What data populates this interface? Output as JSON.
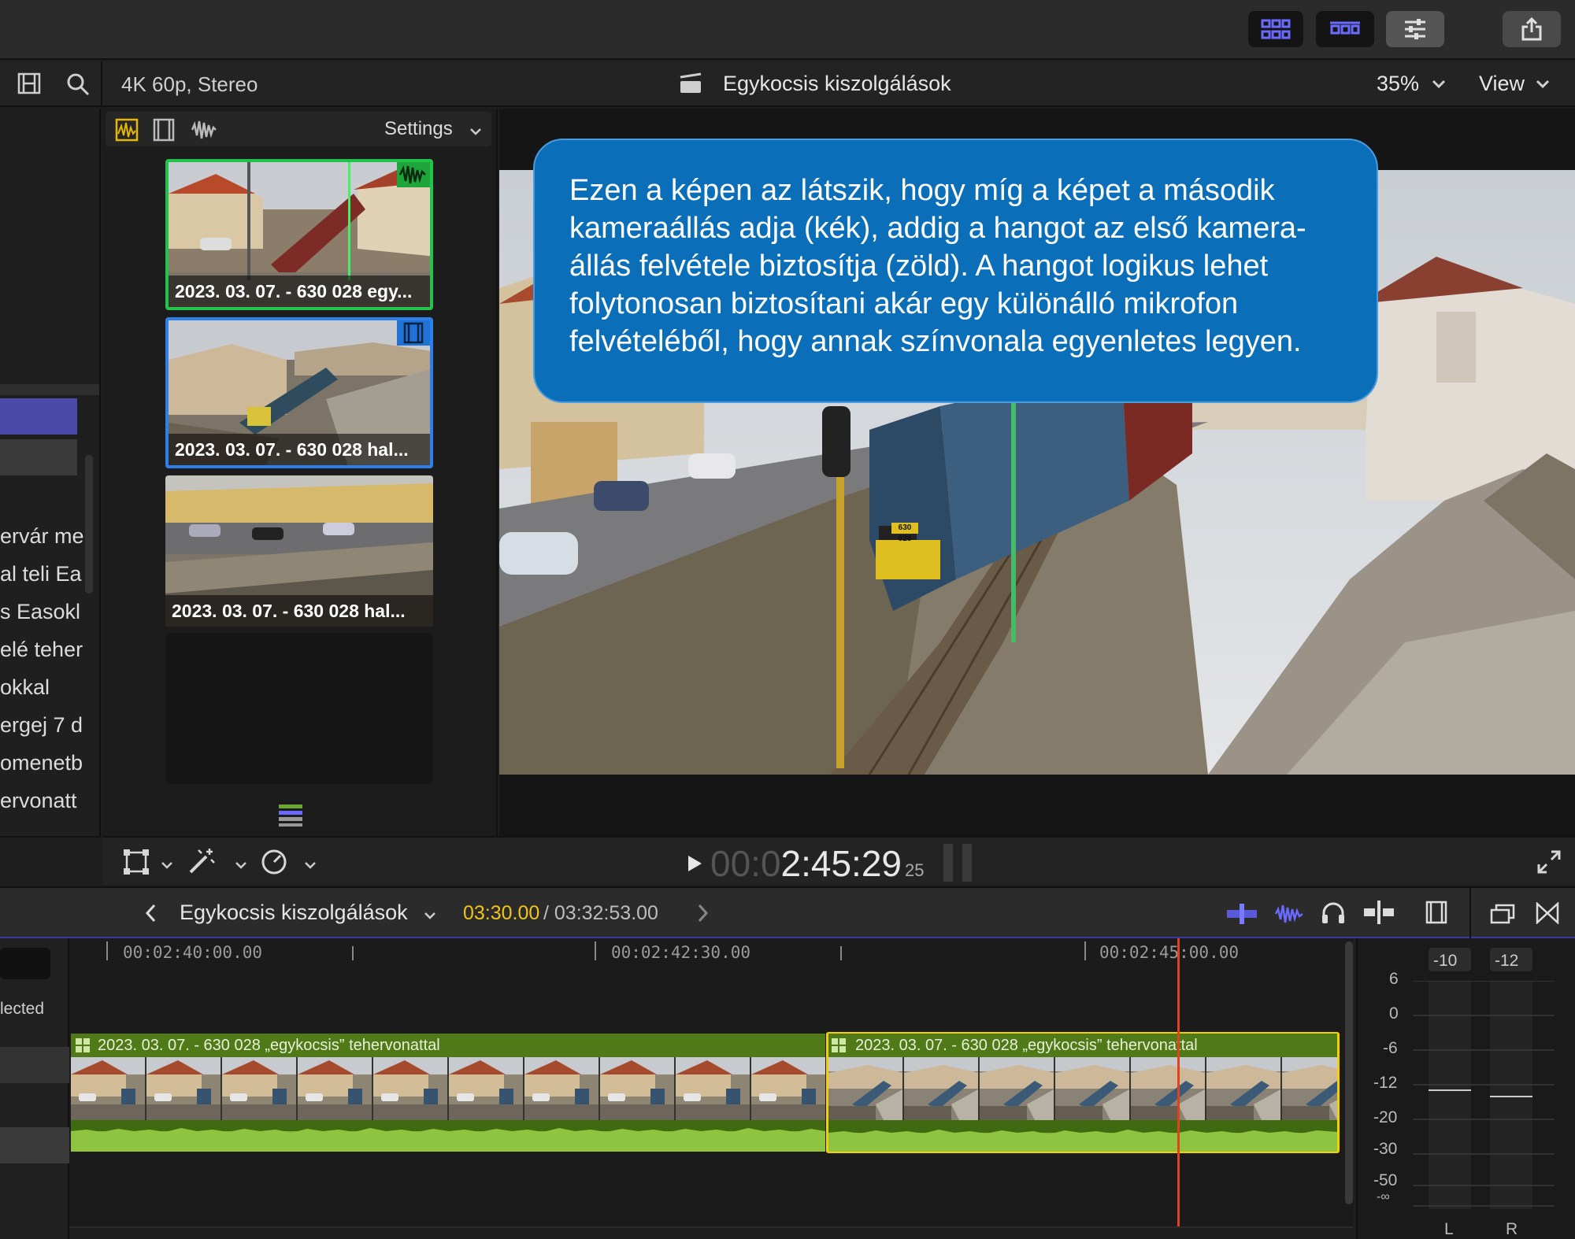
{
  "toolbar": {
    "buttons": [
      "grid-view-icon",
      "filmstrip-view-icon",
      "inspector-icon",
      "share-icon"
    ]
  },
  "sub_bar": {
    "format": "4K 60p, Stereo",
    "project_title": "Egykocsis kiszolgálások",
    "zoom": "35%",
    "view_label": "View"
  },
  "sidebar": {
    "items": [
      "ervár me",
      "al teli Ea",
      "s Easokl",
      "elé teher",
      "okkal",
      "ergej 7 d",
      "omenetb",
      "ervonatt"
    ]
  },
  "browser": {
    "settings_label": "Settings",
    "clips": [
      {
        "name": "2023. 03. 07. - 630 028 egy...",
        "selection": "green"
      },
      {
        "name": "2023. 03. 07. - 630 028 hal...",
        "selection": "blue"
      },
      {
        "name": "2023. 03. 07. - 630 028 hal...",
        "selection": "none"
      }
    ]
  },
  "viewer": {
    "callout": "Ezen a képen az látszik, hogy míg a képet a második kameraállás adja (kék), addig a hangot az első kamera-állás felvétele biztosítja (zöld). A hangot logikus lehet folytonosan biztosítani akár egy különálló mikrofon felvételéből, hogy annak színvonala egyenletes legyen.",
    "loco_number": "630 028"
  },
  "transport": {
    "timecode_dim": "00:0",
    "timecode_main": "2:45:29",
    "timecode_frames": "25"
  },
  "timeline": {
    "project_title": "Egykocsis kiszolgálások",
    "position": "03:30.00",
    "duration": "/ 03:32:53.00",
    "ruler": [
      "00:02:40:00.00",
      "00:02:42:30.00",
      "00:02:45:00.00"
    ],
    "index_label": "lected",
    "clips": [
      {
        "title": "2023. 03. 07. - 630 028 „egykocsis” tehervonattal"
      },
      {
        "title": "2023. 03. 07. - 630 028 „egykocsis” tehervonattal"
      }
    ]
  },
  "meters": {
    "peaks": [
      "-10",
      "-12"
    ],
    "scale": [
      "6",
      "0",
      "-6",
      "-12",
      "-20",
      "-30",
      "-50",
      "-∞"
    ],
    "channels": [
      "L",
      "R"
    ]
  },
  "colors": {
    "accent_blue": "#0a6fb8",
    "clip_green": "#4f7a17",
    "selection_yellow": "#f4d000",
    "playhead": "#e0421b",
    "timecode_yellow": "#f0c419"
  }
}
